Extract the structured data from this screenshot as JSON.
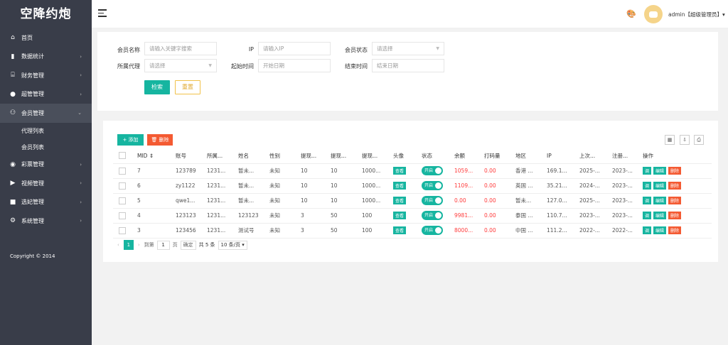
{
  "app": {
    "title": "空降约炮"
  },
  "sidebar": {
    "items": [
      {
        "label": "首页",
        "icon": "home-icon",
        "glyph": "⌂",
        "arrow": false
      },
      {
        "label": "数据统计",
        "icon": "bar-chart-icon",
        "glyph": "▮",
        "arrow": true
      },
      {
        "label": "财务管理",
        "icon": "bank-icon",
        "glyph": "⌸",
        "arrow": true
      },
      {
        "label": "超管管理",
        "icon": "user-icon",
        "glyph": "●",
        "arrow": true
      },
      {
        "label": "会员管理",
        "icon": "users-icon",
        "glyph": "⚇",
        "arrow": true,
        "open": true
      }
    ],
    "sub_items": [
      "代理列表",
      "会员列表"
    ],
    "items_after": [
      {
        "label": "彩票管理",
        "icon": "gamepad-icon",
        "glyph": "◉",
        "arrow": true
      },
      {
        "label": "视频管理",
        "icon": "video-icon",
        "glyph": "▶",
        "arrow": true
      },
      {
        "label": "选妃管理",
        "icon": "camera-icon",
        "glyph": "■",
        "arrow": true
      },
      {
        "label": "系统管理",
        "icon": "gear-icon",
        "glyph": "⚙",
        "arrow": true
      }
    ],
    "copyright": "Copyright © 2014"
  },
  "header": {
    "admin_name": "admin【超级管理员】▾"
  },
  "search": {
    "member_name_label": "会员名称",
    "member_name_placeholder": "请输入关键字搜索",
    "ip_label": "IP",
    "ip_placeholder": "请输入IP",
    "status_label": "会员状态",
    "status_placeholder": "请选择",
    "agent_label": "所属代理",
    "agent_placeholder": "请选择",
    "start_label": "起始时间",
    "start_placeholder": "开始日期",
    "end_label": "结束时间",
    "end_placeholder": "结束日期",
    "search_button": "检索",
    "reset_button": "重置"
  },
  "toolbar": {
    "add_label": "+ 添加",
    "delete_label": "🗑 删除"
  },
  "table": {
    "headers": [
      "MID ⇕",
      "账号",
      "所属...",
      "姓名",
      "性别",
      "提现...",
      "提现...",
      "提现...",
      "头像",
      "状态",
      "余额",
      "打码量",
      "地区",
      "IP",
      "上次...",
      "注册...",
      "操作"
    ],
    "avatar_label": "查看",
    "switch_label": "开启",
    "op_labels": [
      "调",
      "编辑",
      "删除"
    ],
    "rows": [
      [
        "7",
        "123789",
        "1231...",
        "暂未...",
        "未知",
        "10",
        "10",
        "1000...",
        "1059...",
        "0.00",
        "香港 ...",
        "169.1...",
        "2025-...",
        "2023-..."
      ],
      [
        "6",
        "zy1122",
        "1231...",
        "暂未...",
        "未知",
        "10",
        "10",
        "1000...",
        "1109...",
        "0.00",
        "英国 ...",
        "35.21...",
        "2024-...",
        "2023-..."
      ],
      [
        "5",
        "qwe1...",
        "1231...",
        "暂未...",
        "未知",
        "10",
        "10",
        "1000...",
        "0.00",
        "0.00",
        "暂未...",
        "127.0...",
        "2025-...",
        "2023-..."
      ],
      [
        "4",
        "123123",
        "1231...",
        "123123",
        "未知",
        "3",
        "50",
        "100",
        "9981...",
        "0.00",
        "泰国 ...",
        "110.7...",
        "2023-...",
        "2023-..."
      ],
      [
        "3",
        "123456",
        "1231...",
        "测试号",
        "未知",
        "3",
        "50",
        "100",
        "8000...",
        "0.00",
        "中国 ...",
        "111.2...",
        "2022-...",
        "2022-..."
      ]
    ]
  },
  "pager": {
    "prev": "‹",
    "current": "1",
    "next": "›",
    "goto_label": "到第",
    "page_input": "1",
    "page_unit": "页",
    "confirm": "确定",
    "total": "共 5 条",
    "per_page": "10 条/页 ▾"
  }
}
